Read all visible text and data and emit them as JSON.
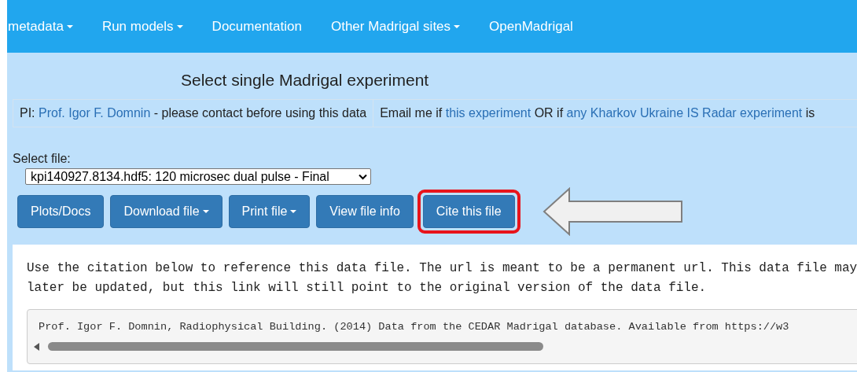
{
  "nav": [
    {
      "label": "metadata",
      "caret": true
    },
    {
      "label": "Run models",
      "caret": true
    },
    {
      "label": "Documentation",
      "caret": false
    },
    {
      "label": "Other Madrigal sites",
      "caret": true
    },
    {
      "label": "OpenMadrigal",
      "caret": false
    }
  ],
  "title": "Select single Madrigal experiment",
  "info_cells": [
    [
      {
        "text": "PI: ",
        "link": false
      },
      {
        "text": "Prof. Igor F. Domnin",
        "link": true
      },
      {
        "text": " - please contact before using this data",
        "link": false
      }
    ],
    [
      {
        "text": "Email me if ",
        "link": false
      },
      {
        "text": "this experiment",
        "link": true
      },
      {
        "text": " OR if ",
        "link": false
      },
      {
        "text": "any Kharkov Ukraine IS Radar experiment",
        "link": true
      },
      {
        "text": " is",
        "link": false
      }
    ]
  ],
  "file_select": {
    "label": "Select file:",
    "value": "kpi140927.8134.hdf5: 120 microsec dual pulse - Final"
  },
  "buttons": [
    {
      "label": "Plots/Docs",
      "caret": false,
      "highlighted": false
    },
    {
      "label": "Download file",
      "caret": true,
      "highlighted": false
    },
    {
      "label": "Print file",
      "caret": true,
      "highlighted": false
    },
    {
      "label": "View file info",
      "caret": false,
      "highlighted": false
    },
    {
      "label": "Cite this file",
      "caret": false,
      "highlighted": true
    }
  ],
  "citation_panel": {
    "intro": "Use the citation below to reference this data file. The url is meant to be a permanent url. This data file may later be updated, but this link will still point to the original version of the data file.",
    "citation": "Prof. Igor F. Domnin, Radiophysical Building. (2014) Data from the CEDAR Madrigal database. Available from https://w3"
  }
}
